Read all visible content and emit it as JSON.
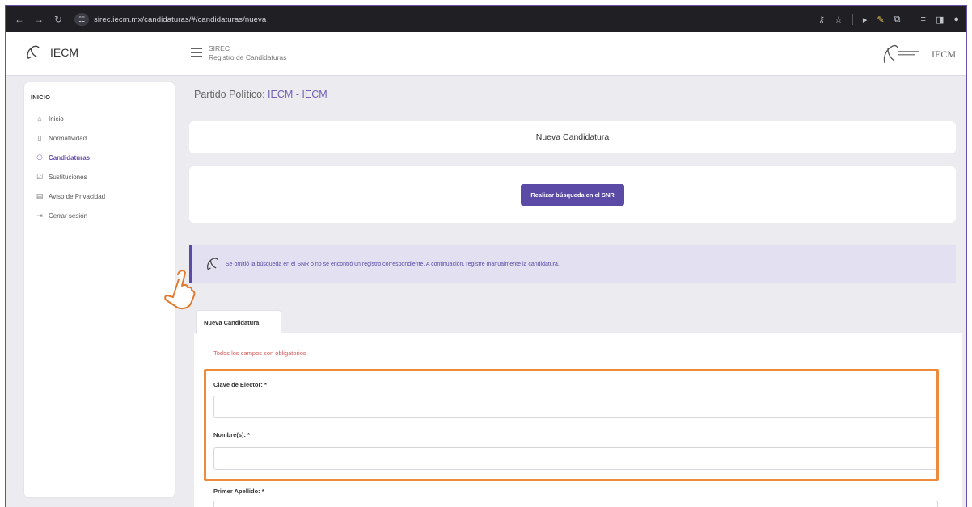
{
  "browser": {
    "url": "sirec.iecm.mx/candidaturas/#/candidaturas/nueva"
  },
  "header": {
    "brand_name": "IECM",
    "system_name": "SIREC",
    "system_subtitle": "Registro de Candidaturas",
    "right_name": "IECM"
  },
  "sidebar": {
    "section": "INICIO",
    "items": [
      {
        "label": "Inicio",
        "icon": "home-icon"
      },
      {
        "label": "Normatividad",
        "icon": "document-icon"
      },
      {
        "label": "Candidaturas",
        "icon": "users-icon",
        "active": true
      },
      {
        "label": "Sustituciones",
        "icon": "check-square-icon"
      },
      {
        "label": "Aviso de Privacidad",
        "icon": "list-box-icon"
      },
      {
        "label": "Cerrar sesión",
        "icon": "logout-icon"
      }
    ]
  },
  "main": {
    "party_label": "Partido Político:",
    "party_value": "IECM - IECM",
    "card_title": "Nueva Candidatura",
    "snr_button": "Realizar búsqueda en el SNR",
    "alert_text": "Se omitió la búsqueda en el SNR o no se encontró un registro correspondiente. A continuación, registre manualmente la candidatura.",
    "form_tab": "Nueva Candidatura",
    "required_note": "Todos los campos son obligatorios",
    "fields": [
      {
        "label": "Clave de Elector: *",
        "value": ""
      },
      {
        "label": "Nombre(s): *",
        "value": ""
      },
      {
        "label": "Primer Apellido: *",
        "value": ""
      }
    ]
  },
  "colors": {
    "accent": "#5b4ba6",
    "highlight": "#ee8a3c",
    "required": "#d25a5a"
  }
}
